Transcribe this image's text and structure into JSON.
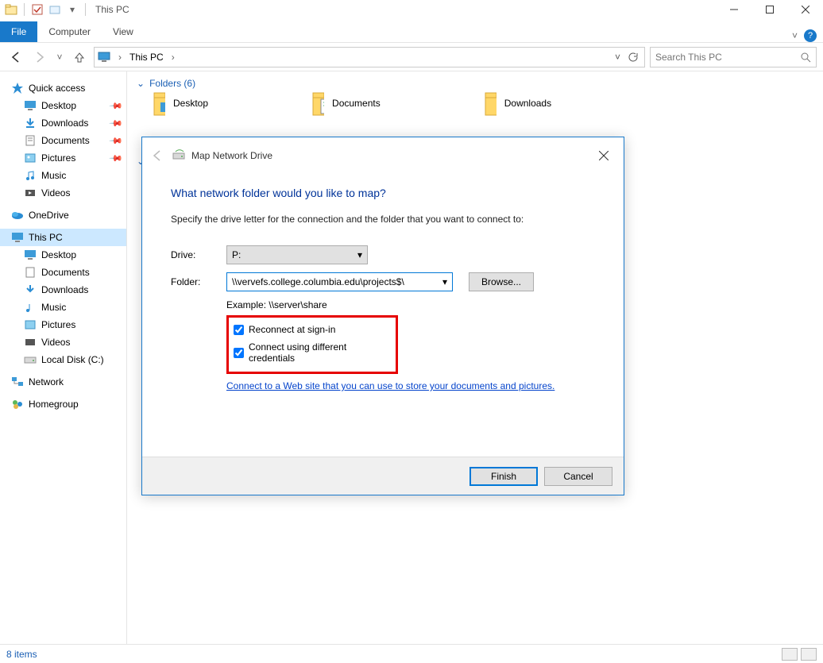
{
  "titlebar": {
    "title": "This PC"
  },
  "tabs": {
    "file": "File",
    "computer": "Computer",
    "view": "View"
  },
  "address": {
    "location": "This PC",
    "search_placeholder": "Search This PC"
  },
  "sidebar": {
    "quick_access": "Quick access",
    "qa_items": [
      {
        "label": "Desktop"
      },
      {
        "label": "Downloads"
      },
      {
        "label": "Documents"
      },
      {
        "label": "Pictures"
      },
      {
        "label": "Music"
      },
      {
        "label": "Videos"
      }
    ],
    "onedrive": "OneDrive",
    "this_pc": "This PC",
    "pc_items": [
      {
        "label": "Desktop"
      },
      {
        "label": "Documents"
      },
      {
        "label": "Downloads"
      },
      {
        "label": "Music"
      },
      {
        "label": "Pictures"
      },
      {
        "label": "Videos"
      },
      {
        "label": "Local Disk (C:)"
      }
    ],
    "network": "Network",
    "homegroup": "Homegroup"
  },
  "content": {
    "section_title": "Folders (6)",
    "folders": [
      {
        "label": "Desktop"
      },
      {
        "label": "Documents"
      },
      {
        "label": "Downloads"
      }
    ]
  },
  "statusbar": {
    "text": "8 items"
  },
  "dialog": {
    "title": "Map Network Drive",
    "heading": "What network folder would you like to map?",
    "subtext": "Specify the drive letter for the connection and the folder that you want to connect to:",
    "drive_label": "Drive:",
    "drive_value": "P:",
    "folder_label": "Folder:",
    "folder_value": "\\\\vervefs.college.columbia.edu\\projects$\\",
    "browse": "Browse...",
    "example": "Example: \\\\server\\share",
    "reconnect": "Reconnect at sign-in",
    "different_creds": "Connect using different credentials",
    "link_text": "Connect to a Web site that you can use to store your documents and pictures",
    "finish": "Finish",
    "cancel": "Cancel"
  }
}
